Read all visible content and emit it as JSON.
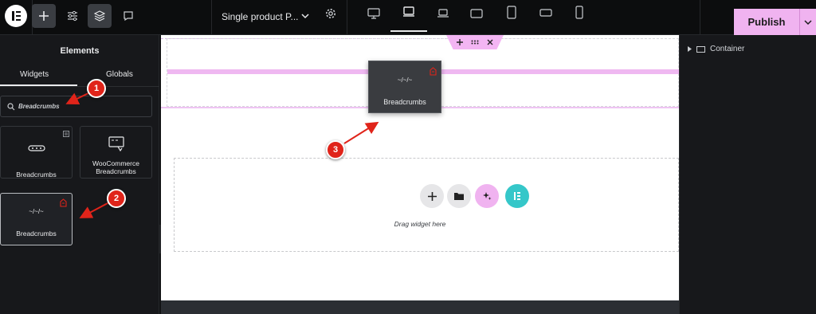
{
  "topbar": {
    "page_title": "Single product P...",
    "publish_label": "Publish",
    "icons": [
      "elementor-logo-icon",
      "add-icon",
      "settings-sliders-icon",
      "layers-icon",
      "comments-icon",
      "chevron-down-icon",
      "gear-icon",
      "desktop-icon",
      "laptop-icon",
      "laptop-small-icon",
      "tablet-landscape-icon",
      "tablet-portrait-icon",
      "mobile-landscape-icon",
      "mobile-icon"
    ]
  },
  "panel": {
    "title": "Elements",
    "tabs": [
      {
        "label": "Widgets",
        "active": true
      },
      {
        "label": "Globals",
        "active": false
      }
    ],
    "search": {
      "value": "Breadcrumbs",
      "placeholder": ""
    },
    "widgets": [
      {
        "label": "Breadcrumbs",
        "icon": "breadcrumbs-icon",
        "pro": true
      },
      {
        "label": "WooCommerce Breadcrumbs",
        "icon": "woocommerce-breadcrumbs-icon",
        "pro": false
      },
      {
        "label": "Breadcrumbs",
        "icon": "breadcrumbs-text-icon",
        "glyph": "~/~/~",
        "selected": true
      }
    ]
  },
  "canvas": {
    "drag_ghost": {
      "label": "Breadcrumbs",
      "glyph": "~/~/~"
    },
    "drop_hint": "Drag widget here",
    "actions": [
      "add-icon",
      "folder-icon",
      "ai-sparkle-icon",
      "elementor-icon"
    ]
  },
  "navigator": {
    "items": [
      {
        "label": "Container"
      }
    ]
  },
  "annotations": [
    "1",
    "2",
    "3"
  ],
  "colors": {
    "accent_pink": "#f0b3f0",
    "annotation_red": "#e0241a",
    "elementor_teal": "#35c7c9"
  }
}
